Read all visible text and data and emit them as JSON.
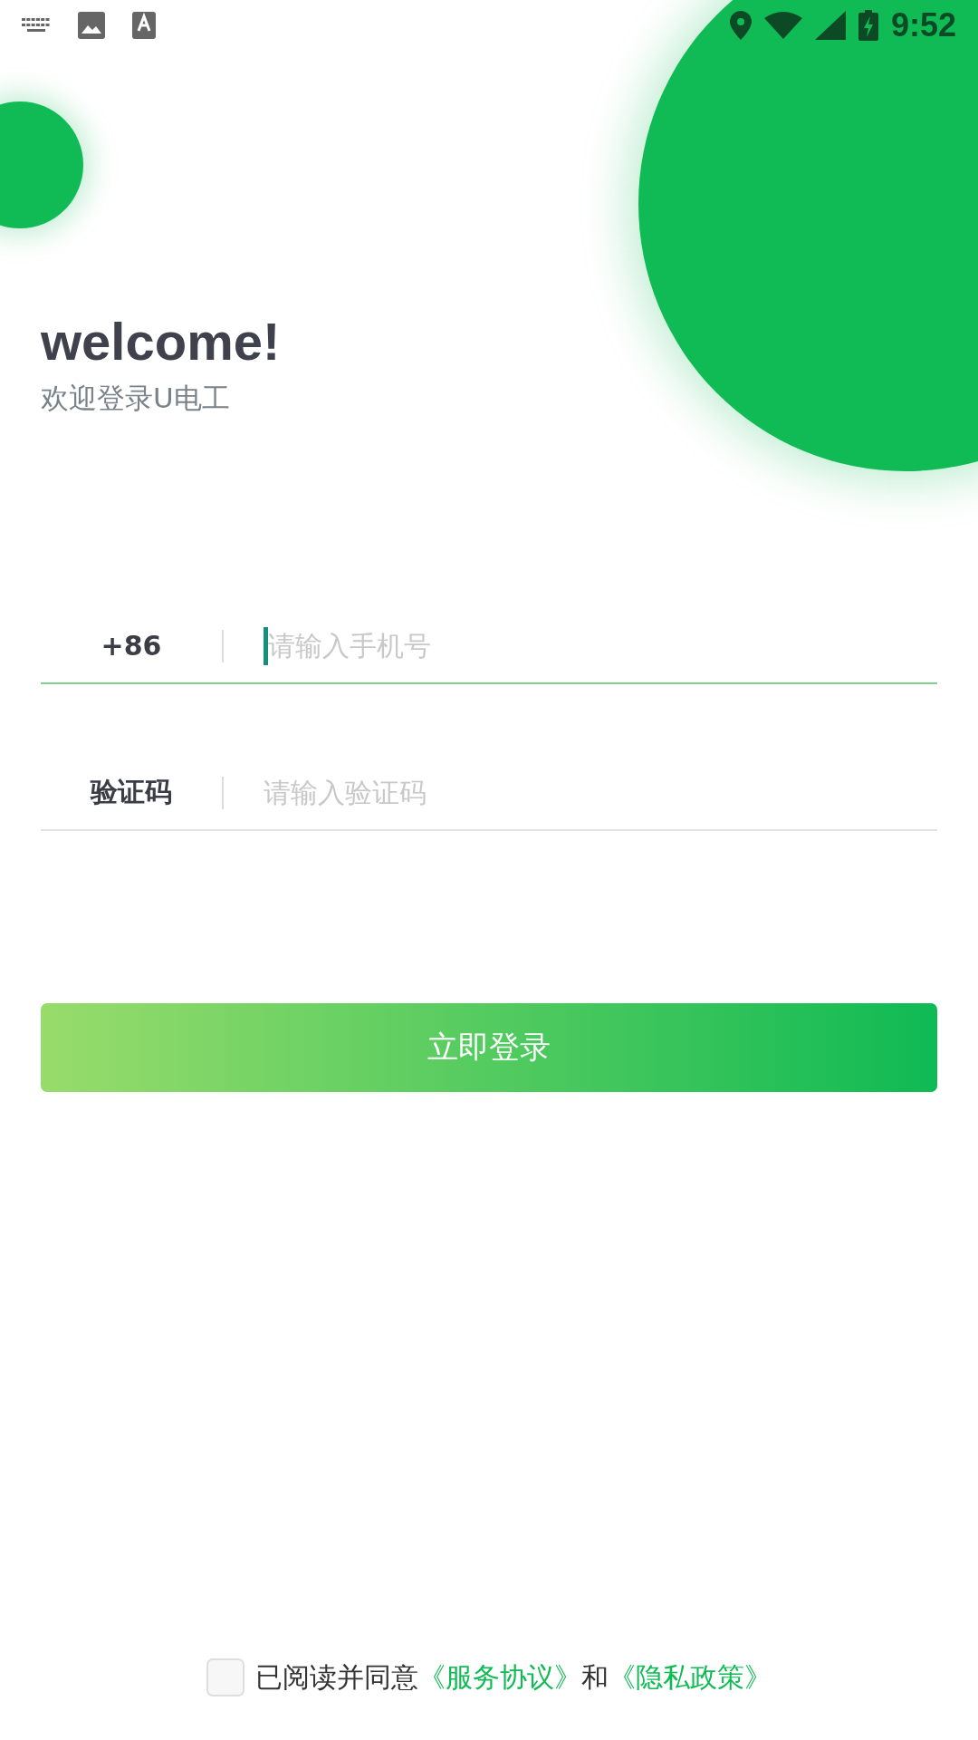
{
  "status_bar": {
    "time": "9:52"
  },
  "header": {
    "title": "welcome!",
    "subtitle": "欢迎登录U电工"
  },
  "fields": [
    {
      "label": "+86",
      "placeholder": "请输入手机号",
      "focused": true
    },
    {
      "label": "验证码",
      "placeholder": "请输入验证码",
      "focused": false
    }
  ],
  "login_button": "立即登录",
  "agreement": {
    "checked": false,
    "text": "已阅读并同意",
    "link_1": "《服务协议》",
    "joiner": "和",
    "link_2": "《隐私政策》"
  }
}
